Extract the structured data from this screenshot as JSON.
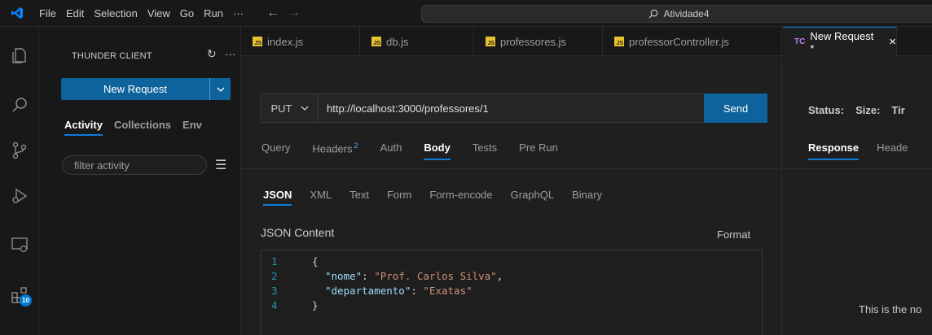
{
  "menu": [
    "File",
    "Edit",
    "Selection",
    "View",
    "Go",
    "Run",
    "···"
  ],
  "command_center": {
    "search_label": "Atividade4"
  },
  "activity_bar": {
    "extensions_badge": "10"
  },
  "sidebar": {
    "title": "THUNDER CLIENT",
    "new_request_label": "New Request",
    "tabs": [
      "Activity",
      "Collections",
      "Env"
    ],
    "filter_placeholder": "filter activity"
  },
  "editor_tabs": [
    {
      "label": "index.js",
      "icon": "js-file-icon"
    },
    {
      "label": "db.js",
      "icon": "js-file-icon"
    },
    {
      "label": "professores.js",
      "icon": "js-file-icon"
    },
    {
      "label": "professorController.js",
      "icon": "js-file-icon"
    },
    {
      "label": "New Request *",
      "icon": "tc-icon",
      "badge": "TC",
      "active": true
    }
  ],
  "request": {
    "method": "PUT",
    "url": "http://localhost:3000/professores/1",
    "send_label": "Send",
    "tabs": [
      {
        "label": "Query"
      },
      {
        "label": "Headers",
        "count": "2"
      },
      {
        "label": "Auth"
      },
      {
        "label": "Body",
        "active": true
      },
      {
        "label": "Tests"
      },
      {
        "label": "Pre Run"
      }
    ],
    "body_tabs": [
      "JSON",
      "XML",
      "Text",
      "Form",
      "Form-encode",
      "GraphQL",
      "Binary"
    ],
    "json_label": "JSON Content",
    "format_label": "Format",
    "code_lines": [
      {
        "num": "1",
        "text": "{"
      },
      {
        "num": "2",
        "key": "\"nome\"",
        "value": "\"Prof. Carlos Silva\"",
        "trailing": ","
      },
      {
        "num": "3",
        "key": "\"departamento\"",
        "value": "\"Exatas\"",
        "trailing": ""
      },
      {
        "num": "4",
        "text": "}"
      }
    ]
  },
  "response": {
    "status_label": "Status:",
    "size_label": "Size:",
    "time_label": "Tir",
    "tabs": [
      "Response",
      "Heade"
    ],
    "empty_text": "This is the no"
  },
  "colors": {
    "accent": "#0e639c",
    "tab_underline": "#0e7cd8",
    "js_icon": "#e8c12f",
    "tc_badge": "#c27cf4"
  }
}
